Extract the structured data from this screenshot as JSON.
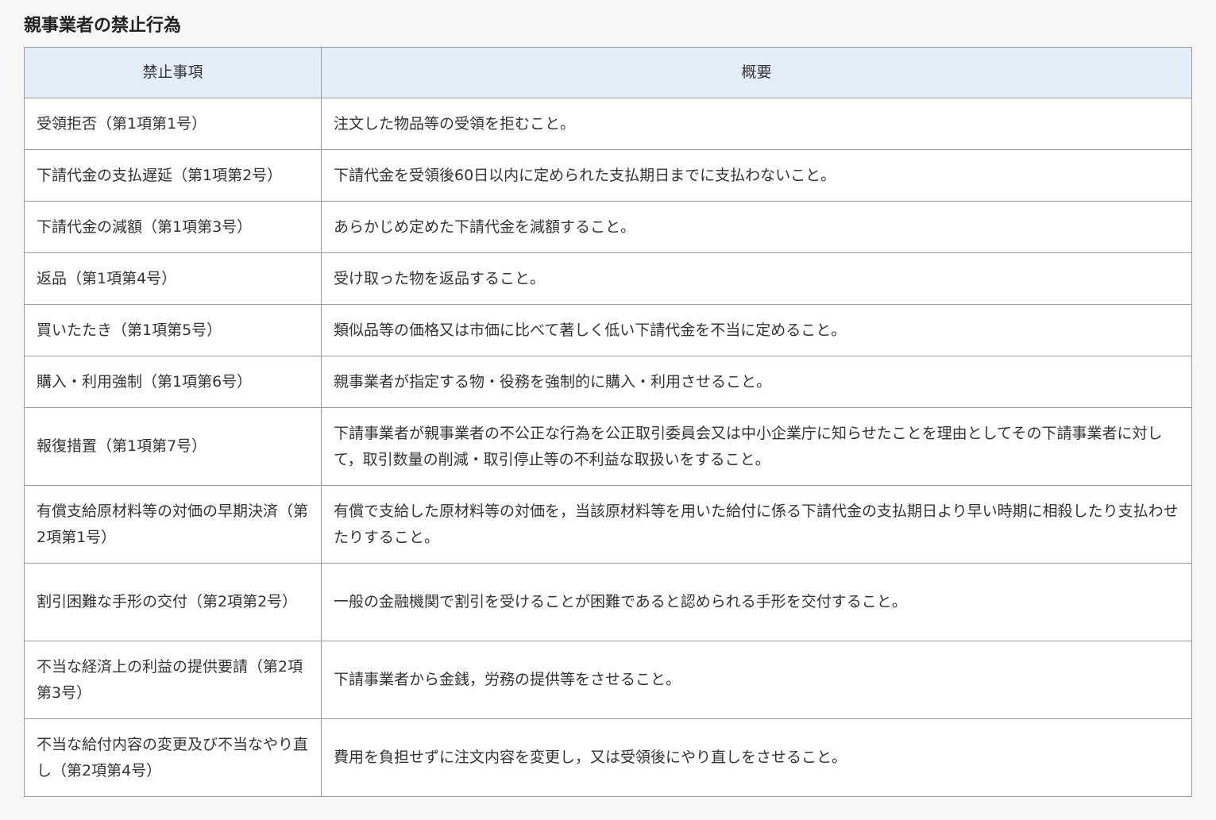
{
  "page": {
    "title": "親事業者の禁止行為"
  },
  "table": {
    "headers": {
      "item": "禁止事項",
      "summary": "概要"
    },
    "rows": [
      {
        "item": "受領拒否（第1項第1号）",
        "summary": "注文した物品等の受領を拒むこと。"
      },
      {
        "item": "下請代金の支払遅延（第1項第2号）",
        "summary": "下請代金を受領後60日以内に定められた支払期日までに支払わないこと。"
      },
      {
        "item": "下請代金の減額（第1項第3号）",
        "summary": "あらかじめ定めた下請代金を減額すること。"
      },
      {
        "item": "返品（第1項第4号）",
        "summary": "受け取った物を返品すること。"
      },
      {
        "item": "買いたたき（第1項第5号）",
        "summary": "類似品等の価格又は市価に比べて著しく低い下請代金を不当に定めること。"
      },
      {
        "item": "購入・利用強制（第1項第6号）",
        "summary": "親事業者が指定する物・役務を強制的に購入・利用させること。"
      },
      {
        "item": "報復措置（第1項第7号）",
        "summary": "下請事業者が親事業者の不公正な行為を公正取引委員会又は中小企業庁に知らせたことを理由としてその下請事業者に対して，取引数量の削減・取引停止等の不利益な取扱いをすること。"
      },
      {
        "item": "有償支給原材料等の対価の早期決済（第2項第1号）",
        "summary": "有償で支給した原材料等の対価を，当該原材料等を用いた給付に係る下請代金の支払期日より早い時期に相殺したり支払わせたりすること。"
      },
      {
        "item": "割引困難な手形の交付（第2項第2号）",
        "summary": "一般の金融機関で割引を受けることが困難であると認められる手形を交付すること。"
      },
      {
        "item": "不当な経済上の利益の提供要請（第2項第3号）",
        "summary": "下請事業者から金銭，労務の提供等をさせること。"
      },
      {
        "item": "不当な給付内容の変更及び不当なやり直し（第2項第4号）",
        "summary": "費用を負担せずに注文内容を変更し，又は受領後にやり直しをさせること。"
      }
    ]
  }
}
